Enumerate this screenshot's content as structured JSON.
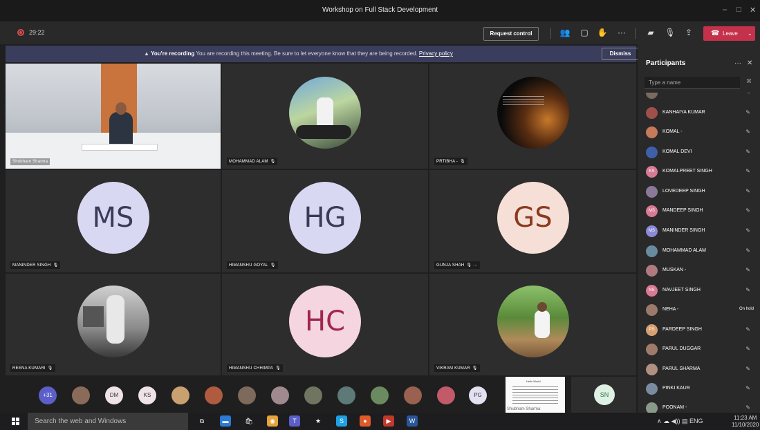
{
  "window": {
    "title": "Workshop on Full Stack Development",
    "controls": [
      "–",
      "□",
      "✕"
    ]
  },
  "toolbar": {
    "timer": "29:22",
    "request_control_label": "Request control",
    "leave_label": "Leave",
    "icons": [
      "participants-icon",
      "chat-icon",
      "raise-hand-icon",
      "more-icon",
      "camera-off-icon",
      "mic-icon",
      "share-icon"
    ]
  },
  "banner": {
    "bold": "You're recording",
    "message": "You are recording this meeting. Be sure to let everyone know that they are being recorded.",
    "link": "Privacy policy",
    "dismiss_label": "Dismiss"
  },
  "tiles": [
    {
      "name": "Shubham Sharma",
      "type": "video"
    },
    {
      "name": "MOHAMMAD ALAM",
      "type": "photo",
      "mic": "🎙"
    },
    {
      "name": "PRTIBHA -",
      "type": "photo",
      "mic": "🎙"
    },
    {
      "name": "MANINDER SINGH",
      "type": "initials",
      "initials": "MS",
      "color": "#d9d8f2",
      "text_color": "#3c3b57",
      "mic": "🎙"
    },
    {
      "name": "HIMANSHU GOYAL",
      "type": "initials",
      "initials": "HG",
      "color": "#d9d8f2",
      "text_color": "#3c3b57",
      "mic": "🎙"
    },
    {
      "name": "GUNJA SHAH",
      "type": "initials",
      "initials": "GS",
      "color": "#f6dfd6",
      "text_color": "#8a3a1e",
      "mic": "🎙 ···"
    },
    {
      "name": "REENA KUMARI",
      "type": "photo",
      "mic": "🎙"
    },
    {
      "name": "HIMANSHU CHHIMPA",
      "type": "initials",
      "initials": "HC",
      "color": "#f5d6e0",
      "text_color": "#a0264f",
      "mic": "🎙"
    },
    {
      "name": "VIKRAM KUMAR",
      "type": "photo",
      "mic": "🎙"
    }
  ],
  "strip": {
    "overflow_count": "+31",
    "avatars": [
      {
        "initials": "",
        "color": "#8a6b5a"
      },
      {
        "initials": "DM",
        "color": "#efe3e8"
      },
      {
        "initials": "KS",
        "color": "#efe3e8"
      },
      {
        "initials": "",
        "color": "#c9a070"
      },
      {
        "initials": "",
        "color": "#b05a40"
      },
      {
        "initials": "",
        "color": "#7d6a5c"
      },
      {
        "initials": "",
        "color": "#a08a90"
      },
      {
        "initials": "",
        "color": "#6f7560"
      },
      {
        "initials": "",
        "color": "#5d7a78"
      },
      {
        "initials": "",
        "color": "#6b8a60"
      },
      {
        "initials": "",
        "color": "#9a6050"
      },
      {
        "initials": "",
        "color": "#c35a6a"
      },
      {
        "initials": "PG",
        "color": "#e3e0f2"
      }
    ],
    "shared_name": "Shubham Sharma",
    "shared_doc_title": "Hello World",
    "sn_initials": "SN"
  },
  "participants": {
    "title": "Participants",
    "search_placeholder": "Type a name",
    "list": [
      {
        "name": "",
        "color": "#7a6a60",
        "status": "mic"
      },
      {
        "name": "KANHAIYA KUMAR",
        "color": "#a0504a",
        "status": "mic"
      },
      {
        "name": "KOMAL -",
        "color": "#c77a5a",
        "status": "mic"
      },
      {
        "name": "KOMAL DEVI",
        "color": "#3f5fa8",
        "status": "mic"
      },
      {
        "name": "KOMALPREET SINGH",
        "color": "#d87a96",
        "initials": "KS",
        "status": "mic"
      },
      {
        "name": "LOVEDEEP SINGH",
        "color": "#8a7a9a",
        "status": "mic"
      },
      {
        "name": "MANDEEP SINGH",
        "color": "#d87a96",
        "initials": "MS",
        "status": "mic"
      },
      {
        "name": "MANINDER SINGH",
        "color": "#8a8ad8",
        "initials": "MS",
        "status": "mic"
      },
      {
        "name": "MOHAMMAD ALAM",
        "color": "#6a8aa0",
        "status": "mic"
      },
      {
        "name": "MUSKAN -",
        "color": "#b07a80",
        "status": "mic"
      },
      {
        "name": "NAVJEET SINGH",
        "color": "#d87a96",
        "initials": "NS",
        "status": "mic"
      },
      {
        "name": "NEHA -",
        "color": "#9a7a6a",
        "status": "hold",
        "status_text": "On hold"
      },
      {
        "name": "PARDEEP SINGH",
        "color": "#d8a070",
        "initials": "PS",
        "status": "mic"
      },
      {
        "name": "PARUL DUGGAR",
        "color": "#a07a6a",
        "status": "mic"
      },
      {
        "name": "PARUL SHARMA",
        "color": "#b09080",
        "status": "mic"
      },
      {
        "name": "PINKI KAUR",
        "color": "#7a8aa0",
        "status": "mic"
      },
      {
        "name": "POONAM -",
        "color": "#8a9a8a",
        "status": "mic"
      }
    ]
  },
  "taskbar": {
    "search_placeholder": "Search the web and Windows",
    "apps": [
      {
        "glyph": "⧉",
        "color": "transparent"
      },
      {
        "glyph": "▬",
        "color": "#2d7ad6"
      },
      {
        "glyph": "🛍",
        "color": "transparent"
      },
      {
        "glyph": "◉",
        "color": "#e8a33a"
      },
      {
        "glyph": "T",
        "color": "#5b5fc7"
      },
      {
        "glyph": "★",
        "color": "transparent"
      },
      {
        "glyph": "S",
        "color": "#1fa1e5"
      },
      {
        "glyph": "●",
        "color": "#e05a2a"
      },
      {
        "glyph": "▶",
        "color": "#c0392b"
      },
      {
        "glyph": "W",
        "color": "#2b579a"
      }
    ],
    "tray": "∧ ☁ ◀)) ▤ ENG",
    "time": "11:23 AM",
    "date": "11/10/2020"
  },
  "colors": {
    "accent": "#5b5fc7",
    "leave": "#c4314b",
    "banner": "#3b3d5c"
  }
}
